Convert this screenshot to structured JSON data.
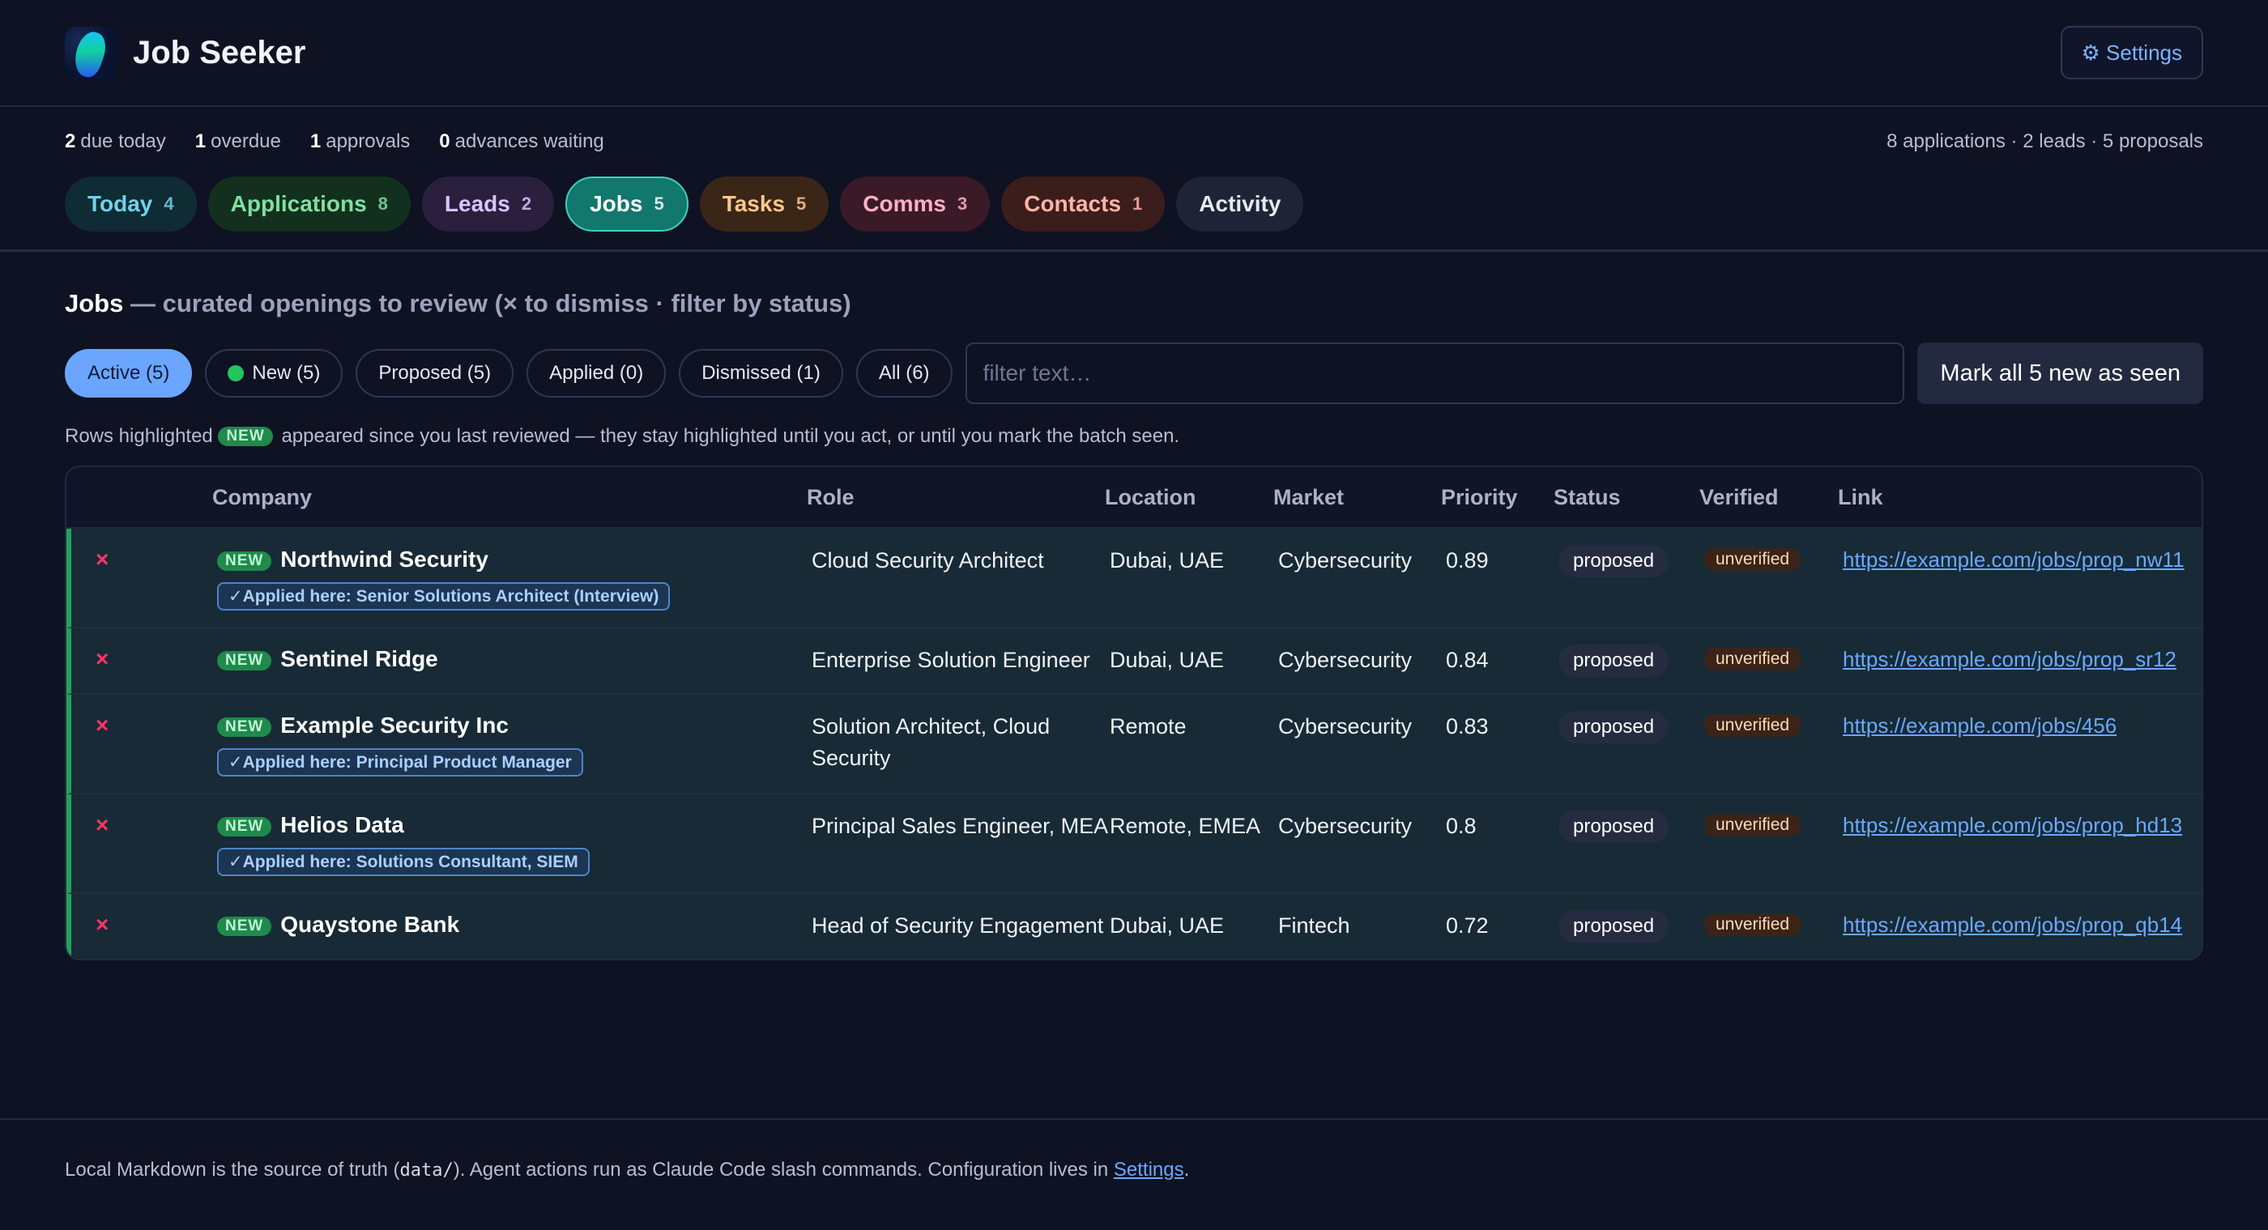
{
  "app": {
    "title": "Job Seeker",
    "settings_label": "⚙ Settings"
  },
  "stats": {
    "due_today": {
      "num": "2",
      "label": "due today"
    },
    "overdue": {
      "num": "1",
      "label": "overdue"
    },
    "approvals": {
      "num": "1",
      "label": "approvals"
    },
    "advances": {
      "num": "0",
      "label": "advances waiting"
    },
    "summary": "8 applications · 2 leads · 5 proposals"
  },
  "tabs": [
    {
      "label": "Today",
      "count": "4"
    },
    {
      "label": "Applications",
      "count": "8"
    },
    {
      "label": "Leads",
      "count": "2"
    },
    {
      "label": "Jobs",
      "count": "5"
    },
    {
      "label": "Tasks",
      "count": "5"
    },
    {
      "label": "Comms",
      "count": "3"
    },
    {
      "label": "Contacts",
      "count": "1"
    },
    {
      "label": "Activity",
      "count": ""
    }
  ],
  "section": {
    "title": "Jobs",
    "subtitle": " — curated openings to review (× to dismiss · filter by status)"
  },
  "filters": {
    "chips": [
      "Active (5)",
      "New (5)",
      "Proposed (5)",
      "Applied (0)",
      "Dismissed (1)",
      "All (6)"
    ],
    "placeholder": "filter text…",
    "mark_label": "Mark all 5 new as seen"
  },
  "note": {
    "before": "Rows highlighted",
    "pill": "NEW",
    "after": "appeared since you last reviewed — they stay highlighted until you act, or until you mark the batch seen."
  },
  "table": {
    "headers": [
      "Company",
      "Role",
      "Location",
      "Market",
      "Priority",
      "Status",
      "Verified",
      "Link"
    ],
    "rows": [
      {
        "x": "×",
        "new": "NEW",
        "company": "Northwind Security",
        "applied": "✓Applied here: Senior Solutions Architect (Interview)",
        "role": "Cloud Security Architect",
        "location": "Dubai, UAE",
        "market": "Cybersecurity",
        "priority": "0.89",
        "status": "proposed",
        "verified": "unverified",
        "link": "https://example.com/jobs/prop_nw11"
      },
      {
        "x": "×",
        "new": "NEW",
        "company": "Sentinel Ridge",
        "applied": "",
        "role": "Enterprise Solution Engineer",
        "location": "Dubai, UAE",
        "market": "Cybersecurity",
        "priority": "0.84",
        "status": "proposed",
        "verified": "unverified",
        "link": "https://example.com/jobs/prop_sr12"
      },
      {
        "x": "×",
        "new": "NEW",
        "company": "Example Security Inc",
        "applied": "✓Applied here: Principal Product Manager",
        "role": "Solution Architect, Cloud Security",
        "location": "Remote",
        "market": "Cybersecurity",
        "priority": "0.83",
        "status": "proposed",
        "verified": "unverified",
        "link": "https://example.com/jobs/456"
      },
      {
        "x": "×",
        "new": "NEW",
        "company": "Helios Data",
        "applied": "✓Applied here: Solutions Consultant, SIEM",
        "role": "Principal Sales Engineer, MEA",
        "location": "Remote, EMEA",
        "market": "Cybersecurity",
        "priority": "0.8",
        "status": "proposed",
        "verified": "unverified",
        "link": "https://example.com/jobs/prop_hd13"
      },
      {
        "x": "×",
        "new": "NEW",
        "company": "Quaystone Bank",
        "applied": "",
        "role": "Head of Security Engagement",
        "location": "Dubai, UAE",
        "market": "Fintech",
        "priority": "0.72",
        "status": "proposed",
        "verified": "unverified",
        "link": "https://example.com/jobs/prop_qb14"
      }
    ]
  },
  "footer": {
    "text1": "Local Markdown is the source of truth (",
    "code": "data/",
    "text2": "). Agent actions run as Claude Code slash commands. Configuration lives in ",
    "link": "Settings",
    "text3": "."
  }
}
